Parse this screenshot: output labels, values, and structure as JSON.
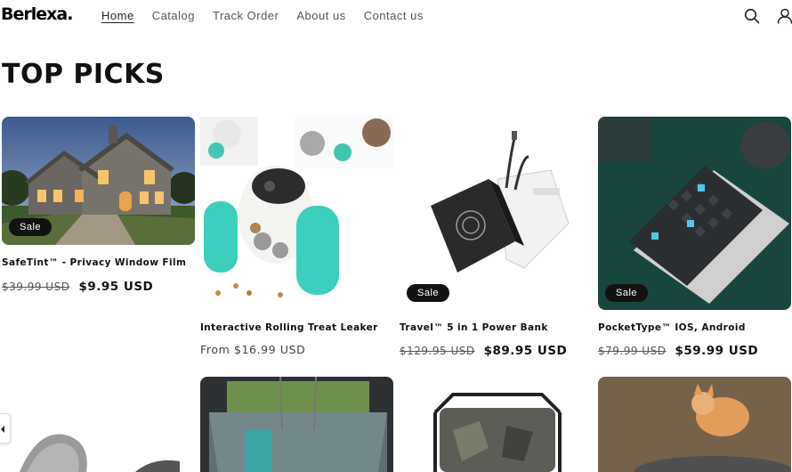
{
  "header": {
    "logo": "Berlexa.",
    "nav": [
      {
        "label": "Home",
        "active": true
      },
      {
        "label": "Catalog",
        "active": false
      },
      {
        "label": "Track Order",
        "active": false
      },
      {
        "label": "About us",
        "active": false
      },
      {
        "label": "Contact us",
        "active": false
      }
    ],
    "icons": [
      "search-icon",
      "account-icon"
    ]
  },
  "section": {
    "title": "TOP PICKS"
  },
  "products": [
    {
      "title": "SafeTint™ - Privacy Window Film",
      "badge": "Sale",
      "price_old": "$39.99 USD",
      "price_new": "$9.95 USD"
    },
    {
      "title": "Interactive Rolling Treat Leaker",
      "badge": "",
      "price_from": "From $16.99 USD"
    },
    {
      "title": "Travel™ 5 in 1 Power Bank",
      "badge": "Sale",
      "price_old": "$129.95 USD",
      "price_new": "$89.95 USD"
    },
    {
      "title": "PocketType™ IOS, Android",
      "badge": "Sale",
      "price_old": "$79.99 USD",
      "price_new": "$59.99 USD"
    }
  ],
  "colors": {
    "text": "#121212",
    "badge_bg": "#121212",
    "badge_text": "#ffffff",
    "muted": "#555555"
  }
}
